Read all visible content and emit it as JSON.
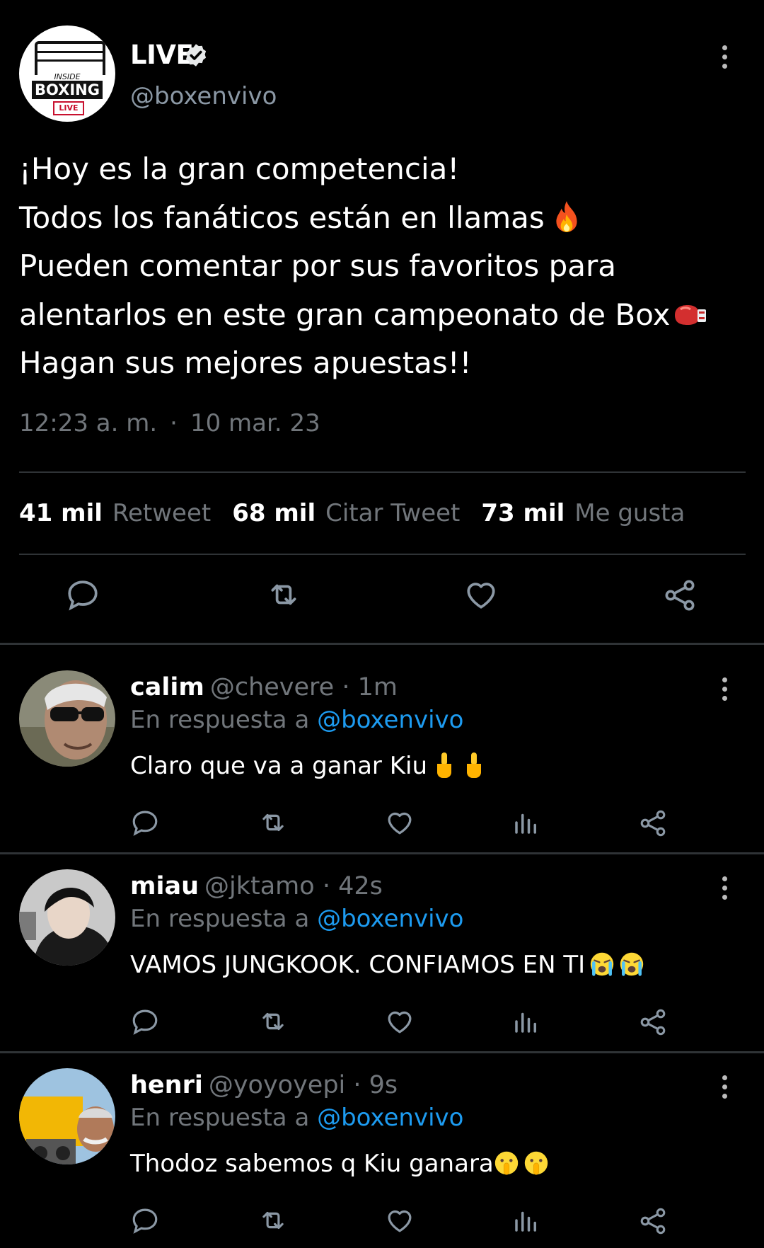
{
  "tweet": {
    "author_name": "LIVE",
    "author_handle": "@boxenvivo",
    "verified": true,
    "avatar_logo": {
      "line1": "INSIDE",
      "line2": "BOXING",
      "line3": "LIVE"
    },
    "text_lines": [
      "¡Hoy es la gran competencia!",
      "Todos los fanáticos están en llamas",
      "Pueden comentar por sus favoritos para",
      "alentarlos en este gran campeonato de Box",
      "Hagan sus mejores apuestas!!"
    ],
    "time": "12:23 a. m.",
    "separator": "·",
    "date": "10 mar. 23",
    "stats": [
      {
        "count": "41 mil",
        "label": "Retweet"
      },
      {
        "count": "68 mil",
        "label": "Citar Tweet"
      },
      {
        "count": "73 mil",
        "label": "Me gusta"
      }
    ]
  },
  "replies": [
    {
      "name": "calim",
      "meta": "@chevere · 1m",
      "in_reply_prefix": "En respuesta a",
      "mention": "@boxenvivo",
      "text": "Claro que va a ganar Kiu",
      "emoji": [
        "pointing-finger",
        "pointing-finger"
      ]
    },
    {
      "name": "miau",
      "meta": "@jktamo · 42s",
      "in_reply_prefix": "En respuesta a",
      "mention": "@boxenvivo",
      "text": "VAMOS JUNGKOOK. CONFIAMOS EN TI",
      "emoji": [
        "crying-face",
        "crying-face"
      ]
    },
    {
      "name": "henri",
      "meta": "@yoyoyepi · 9s",
      "in_reply_prefix": "En respuesta a",
      "mention": "@boxenvivo",
      "text": "Thodoz sabemos q Kiu ganara",
      "emoji": [
        "shushing-face",
        "shushing-face"
      ]
    }
  ],
  "icons": {
    "reply": "reply-icon",
    "retweet": "retweet-icon",
    "like": "heart-icon",
    "views": "analytics-icon",
    "share": "share-icon",
    "more": "more-options-icon",
    "verified": "verified-badge-icon"
  },
  "colors": {
    "background": "#000000",
    "muted_text": "#71767b",
    "mention": "#1d9bf0",
    "divider": "#2f3336"
  }
}
